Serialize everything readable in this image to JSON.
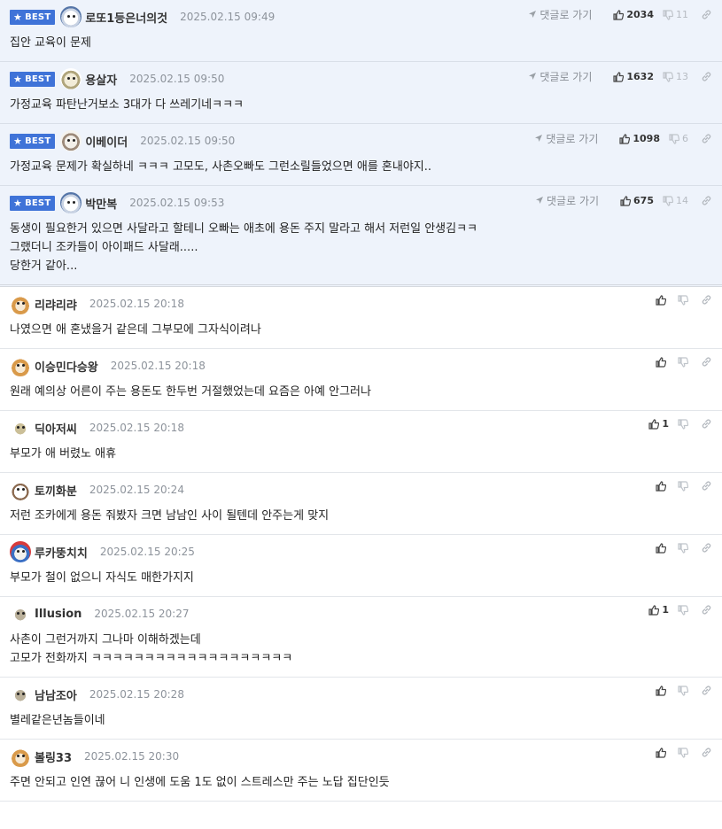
{
  "labels": {
    "best": "BEST",
    "goto": "댓글로 가기"
  },
  "best_comments": [
    {
      "nick": "로또1등은너의것",
      "date": "2025.02.15 09:49",
      "up": "2034",
      "down": "11",
      "avatar": "av-bear",
      "text": "집안 교육이 문제"
    },
    {
      "nick": "용살자",
      "date": "2025.02.15 09:50",
      "up": "1632",
      "down": "13",
      "avatar": "av-seal",
      "text": "가정교육 파탄난거보소 3대가 다 쓰레기네ㅋㅋㅋ"
    },
    {
      "nick": "이베이더",
      "date": "2025.02.15 09:50",
      "up": "1098",
      "down": "6",
      "avatar": "av-dog",
      "text": "가정교육 문제가 확실하네 ㅋㅋㅋ 고모도, 사촌오빠도 그런소릴들었으면 애를 혼내야지.."
    },
    {
      "nick": "박만복",
      "date": "2025.02.15 09:53",
      "up": "675",
      "down": "14",
      "avatar": "av-bear",
      "text": "동생이 필요한거 있으면 사달라고 할테니 오빠는 애초에 용돈 주지 말라고 해서 저런일 안생김ㅋㅋ\n그랬더니 조카들이 아이패드 사달래.....\n당한거 같아..."
    }
  ],
  "comments": [
    {
      "nick": "리랴리랴",
      "date": "2025.02.15 20:18",
      "up": "",
      "avatar": "av-cat",
      "text": "나였으면 애 혼냈을거 같은데 그부모에 그자식이려나"
    },
    {
      "nick": "이승민다승왕",
      "date": "2025.02.15 20:18",
      "up": "",
      "avatar": "av-cat",
      "text": "원래 예의상 어른이 주는 용돈도 한두번 거절했었는데 요즘은 아예 안그러나"
    },
    {
      "nick": "딕아저씨",
      "date": "2025.02.15 20:18",
      "up": "1",
      "avatar": "av-blob",
      "text": "부모가 애 버렸노 애휴"
    },
    {
      "nick": "토끼화분",
      "date": "2025.02.15 20:24",
      "up": "",
      "avatar": "av-pup",
      "text": "저런 조카에게 용돈 줘봤자 크면 남남인 사이 될텐데 안주는게 맞지"
    },
    {
      "nick": "루카뚱치치",
      "date": "2025.02.15 20:25",
      "up": "",
      "avatar": "av-cat2",
      "text": "부모가 철이 없으니 자식도 매한가지지"
    },
    {
      "nick": "Illusion",
      "date": "2025.02.15 20:27",
      "up": "1",
      "avatar": "av-bean",
      "text": "사촌이 그런거까지 그나마 이해하겠는데\n고모가 전화까지 ㅋㅋㅋㅋㅋㅋㅋㅋㅋㅋㅋㅋㅋㅋㅋㅋㅋㅋㅋ"
    },
    {
      "nick": "남남조아",
      "date": "2025.02.15 20:28",
      "up": "",
      "avatar": "av-bean",
      "text": "별레같은년놈들이네"
    },
    {
      "nick": "볼링33",
      "date": "2025.02.15 20:30",
      "up": "",
      "avatar": "av-cat",
      "text": "주면 안되고 인연 끊어 니 인생에 도움 1도 없이 스트레스만 주는 노답 집단인듯"
    }
  ]
}
